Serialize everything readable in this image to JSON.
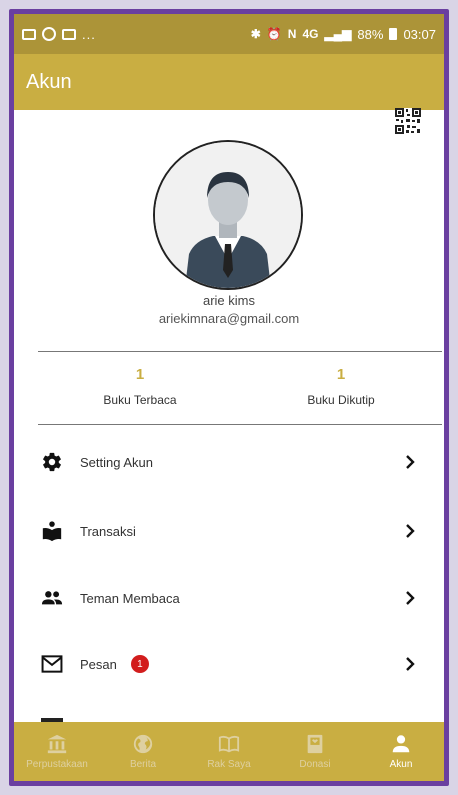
{
  "status_bar": {
    "dots": "...",
    "network": "4G",
    "battery": "88%",
    "time": "03:07"
  },
  "app_bar": {
    "title": "Akun"
  },
  "profile": {
    "name": "arie kims",
    "email": "ariekimnara@gmail.com"
  },
  "stats": [
    {
      "value": "1",
      "label": "Buku Terbaca"
    },
    {
      "value": "1",
      "label": "Buku Dikutip"
    }
  ],
  "menu": [
    {
      "label": "Setting Akun",
      "icon": "gear-icon"
    },
    {
      "label": "Transaksi",
      "icon": "book-reader-icon"
    },
    {
      "label": "Teman Membaca",
      "icon": "people-icon"
    },
    {
      "label": "Pesan",
      "icon": "mail-icon",
      "badge": "1"
    }
  ],
  "bottom_nav": [
    {
      "label": "Perpustakaan",
      "icon": "library-icon",
      "active": false
    },
    {
      "label": "Berita",
      "icon": "globe-icon",
      "active": false
    },
    {
      "label": "Rak Saya",
      "icon": "open-book-icon",
      "active": false
    },
    {
      "label": "Donasi",
      "icon": "donation-book-icon",
      "active": false
    },
    {
      "label": "Akun",
      "icon": "person-icon",
      "active": true
    }
  ],
  "colors": {
    "status_bar": "#ac9438",
    "app_bar": "#c9ae42",
    "accent": "#c9ae42",
    "badge": "#d21d1d",
    "frame": "#6a3fa0"
  }
}
